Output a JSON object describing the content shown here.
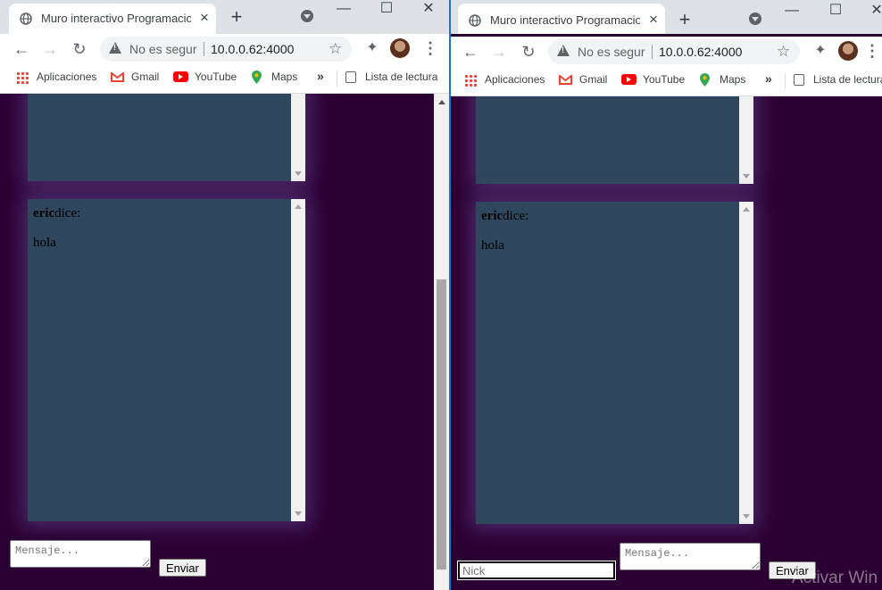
{
  "windows": [
    {
      "tab_title": "Muro interactivo Programacion",
      "security": "No es segur",
      "url": "10.0.0.62:4000",
      "bookmarks": {
        "apps": "Aplicaciones",
        "gmail": "Gmail",
        "youtube": "YouTube",
        "maps": "Maps",
        "more": "»",
        "reading_list": "Lista de lectura"
      },
      "message": {
        "author": "eric",
        "verb": "dice:",
        "text": "hola"
      },
      "input_placeholder": "Mensaje...",
      "send_label": "Enviar"
    },
    {
      "tab_title": "Muro interactivo Programacion",
      "security": "No es segur",
      "url": "10.0.0.62:4000",
      "bookmarks": {
        "apps": "Aplicaciones",
        "gmail": "Gmail",
        "youtube": "YouTube",
        "maps": "Maps",
        "more": "»",
        "reading_list": "Lista de lectura"
      },
      "message": {
        "author": "eric",
        "verb": "dice:",
        "text": "hola"
      },
      "nick_placeholder": "Nick",
      "input_placeholder": "Mensaje...",
      "send_label": "Enviar"
    }
  ],
  "watermark": "Activar Win",
  "colors": {
    "page_bg": "#2a0033",
    "panel_bg": "#2e475c",
    "glow": "#7a5fb0"
  }
}
